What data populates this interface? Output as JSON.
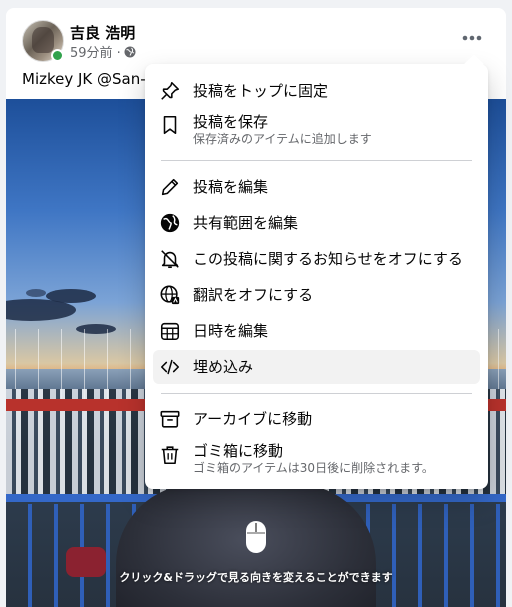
{
  "post": {
    "author": "吉良 浩明",
    "time": "59分前 ·",
    "privacy_icon": "globe-icon",
    "text": "Mizkey JK @San-F",
    "more_icon": "more-horizontal-icon",
    "panorama_hint": "クリック&ドラッグで見る向きを変えることができます"
  },
  "menu": {
    "items": [
      {
        "icon": "pin-icon",
        "label": "投稿をトップに固定"
      },
      {
        "icon": "bookmark-icon",
        "label": "投稿を保存",
        "sub": "保存済みのアイテムに追加します"
      },
      {
        "icon": "pencil-icon",
        "label": "投稿を編集"
      },
      {
        "icon": "globe-icon",
        "label": "共有範囲を編集"
      },
      {
        "icon": "bell-off-icon",
        "label": "この投稿に関するお知らせをオフにする"
      },
      {
        "icon": "translate-icon",
        "label": "翻訳をオフにする"
      },
      {
        "icon": "calendar-icon",
        "label": "日時を編集"
      },
      {
        "icon": "code-icon",
        "label": "埋め込み"
      },
      {
        "icon": "archive-icon",
        "label": "アーカイブに移動"
      },
      {
        "icon": "trash-icon",
        "label": "ゴミ箱に移動",
        "sub": "ゴミ箱のアイテムは30日後に削除されます。"
      }
    ]
  },
  "colors": {
    "online": "#31a24c",
    "highlight": "#f2f2f2",
    "secondary_text": "#65676b"
  }
}
